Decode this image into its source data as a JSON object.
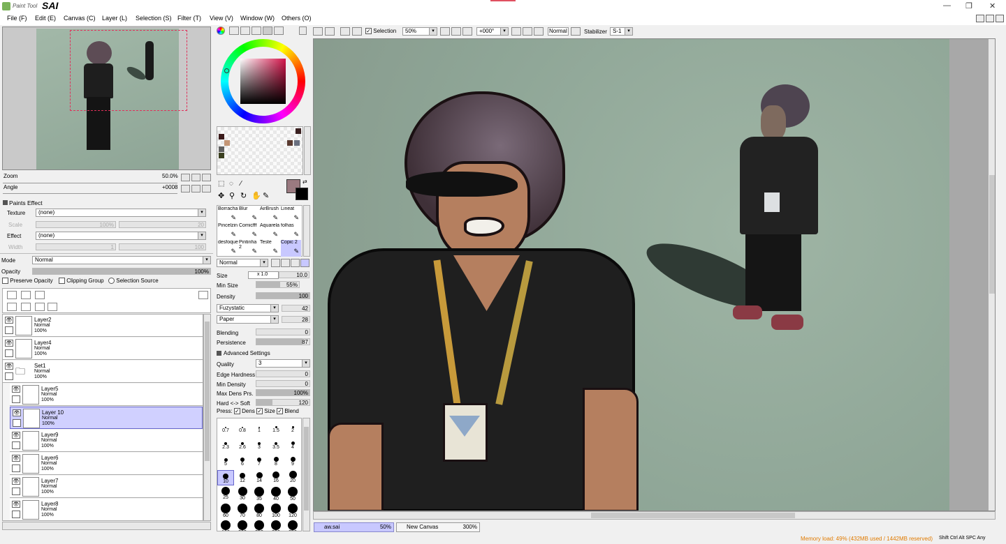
{
  "app": {
    "logo_small": "Paint Tool",
    "logo_big": "SAI"
  },
  "menu": [
    "File (F)",
    "Edit (E)",
    "Canvas (C)",
    "Layer (L)",
    "Selection (S)",
    "Filter (T)",
    "View (V)",
    "Window (W)",
    "Others (O)"
  ],
  "navigator": {
    "zoom_label": "Zoom",
    "zoom_value": "50.0%",
    "angle_label": "Angle",
    "angle_value": "+0008"
  },
  "paints_effect": {
    "title": "Paints Effect",
    "texture_label": "Texture",
    "texture_value": "(none)",
    "scale_label": "Scale",
    "scale_value": "100%",
    "scale_right": "20",
    "effect_label": "Effect",
    "effect_value": "(none)",
    "width_label": "Width",
    "width_value": "1",
    "width_right": "100"
  },
  "layer_props": {
    "mode_label": "Mode",
    "mode_value": "Normal",
    "opacity_label": "Opacity",
    "opacity_value": "100%",
    "preserve_opacity": "Preserve Opacity",
    "clipping_group": "Clipping Group",
    "selection_source": "Selection Source"
  },
  "layers": [
    {
      "name": "Layer2",
      "mode": "Normal",
      "opacity": "100%",
      "indent": false,
      "selected": false,
      "folder": false
    },
    {
      "name": "Layer4",
      "mode": "Normal",
      "opacity": "100%",
      "indent": false,
      "selected": false,
      "folder": false
    },
    {
      "name": "Set1",
      "mode": "Normal",
      "opacity": "100%",
      "indent": false,
      "selected": false,
      "folder": true
    },
    {
      "name": "Layer5",
      "mode": "Normal",
      "opacity": "100%",
      "indent": true,
      "selected": false,
      "folder": false
    },
    {
      "name": "Layer 10",
      "mode": "Normal",
      "opacity": "100%",
      "indent": true,
      "selected": true,
      "folder": false
    },
    {
      "name": "Layer9",
      "mode": "Normal",
      "opacity": "100%",
      "indent": true,
      "selected": false,
      "folder": false
    },
    {
      "name": "Layer6",
      "mode": "Normal",
      "opacity": "100%",
      "indent": true,
      "selected": false,
      "folder": false
    },
    {
      "name": "Layer7",
      "mode": "Normal",
      "opacity": "100%",
      "indent": true,
      "selected": false,
      "folder": false
    },
    {
      "name": "Layer8",
      "mode": "Normal",
      "opacity": "100%",
      "indent": true,
      "selected": false,
      "folder": false
    }
  ],
  "brushes": [
    [
      "Borracha",
      "Blur",
      "AirBrush",
      "Lineat"
    ],
    [
      "Pincelzin",
      "Comicfff",
      "Aquarela",
      "folhas"
    ],
    [
      "desfoque",
      "Pintinha 2",
      "Teste",
      "Copic 2"
    ]
  ],
  "tool_settings": {
    "blend_mode": "Normal",
    "size_label": "Size",
    "size_mult": "x 1.0",
    "size_value": "10.0",
    "min_size_label": "Min Size",
    "min_size_value": "55%",
    "density_label": "Density",
    "density_value": "100",
    "shape_value": "Fuzystatic",
    "shape_num": "42",
    "texture_value": "Paper",
    "texture_num": "28",
    "blending_label": "Blending",
    "blending_value": "0",
    "persistence_label": "Persistence",
    "persistence_value": "87",
    "advanced_label": "Advanced Settings",
    "quality_label": "Quality",
    "quality_value": "3",
    "edge_label": "Edge Hardness",
    "edge_value": "0",
    "min_density_label": "Min Density",
    "min_density_value": "0",
    "max_dens_label": "Max Dens Prs.",
    "max_dens_value": "100%",
    "hard_soft_label": "Hard <-> Soft",
    "hard_soft_value": "120",
    "press_label": "Press:",
    "press_dens": "Dens",
    "press_size": "Size",
    "press_blend": "Blend"
  },
  "brush_sizes": [
    "0.7",
    "0.8",
    "1",
    "1.5",
    "2",
    "2.3",
    "2.6",
    "3",
    "3.5",
    "4",
    "5",
    "6",
    "7",
    "8",
    "9",
    "10",
    "12",
    "14",
    "16",
    "20",
    "25",
    "30",
    "35",
    "40",
    "50",
    "60",
    "70",
    "80",
    "100",
    "120",
    "160",
    "200",
    "250",
    "300",
    "350"
  ],
  "canvas_toolbar": {
    "selection_label": "Selection",
    "zoom_value": "50%",
    "angle_value": "+000°",
    "mode_value": "Normal",
    "stabilizer_label": "Stabilizer",
    "stabilizer_value": "S-1"
  },
  "tabs": [
    {
      "name": "aw.sai",
      "zoom": "50%",
      "active": true
    },
    {
      "name": "New Canvas",
      "zoom": "300%",
      "active": false
    }
  ],
  "status": {
    "memory": "Memory load: 49% (432MB used / 1442MB reserved)",
    "keys": "Shift Ctrl Alt SPC  Any"
  },
  "colors": {
    "accent": "#c8c8ff",
    "canvas_bg": "#8fa898",
    "current_color": "#9a7a80",
    "memory_text": "#e07a00"
  }
}
